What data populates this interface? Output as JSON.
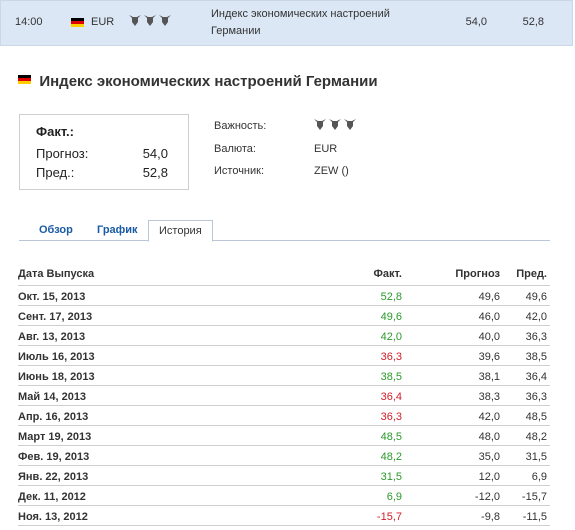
{
  "event_row": {
    "time": "14:00",
    "currency": "EUR",
    "importance": 3,
    "name": "Индекс экономических настроений Германии",
    "actual": "54,0",
    "previous": "52,8"
  },
  "title": "Индекс экономических настроений Германии",
  "fact_box": {
    "fact_label": "Факт.:",
    "forecast_label": "Прогноз:",
    "forecast_value": "54,0",
    "previous_label": "Пред.:",
    "previous_value": "52,8"
  },
  "meta": {
    "importance_label": "Важность:",
    "importance": 3,
    "currency_label": "Валюта:",
    "currency_value": "EUR",
    "source_label": "Источник:",
    "source_value": "ZEW ()"
  },
  "tabs": [
    "Обзор",
    "График",
    "История"
  ],
  "active_tab": "История",
  "history": {
    "headers": {
      "date": "Дата Выпуска",
      "actual": "Факт.",
      "forecast": "Прогноз",
      "previous": "Пред."
    },
    "rows": [
      {
        "date": "Окт. 15, 2013",
        "actual": "52,8",
        "actual_status": "green",
        "forecast": "49,6",
        "previous": "49,6"
      },
      {
        "date": "Сент. 17, 2013",
        "actual": "49,6",
        "actual_status": "green",
        "forecast": "46,0",
        "previous": "42,0"
      },
      {
        "date": "Авг. 13, 2013",
        "actual": "42,0",
        "actual_status": "green",
        "forecast": "40,0",
        "previous": "36,3"
      },
      {
        "date": "Июль 16, 2013",
        "actual": "36,3",
        "actual_status": "red",
        "forecast": "39,6",
        "previous": "38,5"
      },
      {
        "date": "Июнь 18, 2013",
        "actual": "38,5",
        "actual_status": "green",
        "forecast": "38,1",
        "previous": "36,4"
      },
      {
        "date": "Май 14, 2013",
        "actual": "36,4",
        "actual_status": "red",
        "forecast": "38,3",
        "previous": "36,3"
      },
      {
        "date": "Апр. 16, 2013",
        "actual": "36,3",
        "actual_status": "red",
        "forecast": "42,0",
        "previous": "48,5"
      },
      {
        "date": "Март 19, 2013",
        "actual": "48,5",
        "actual_status": "green",
        "forecast": "48,0",
        "previous": "48,2"
      },
      {
        "date": "Фев. 19, 2013",
        "actual": "48,2",
        "actual_status": "green",
        "forecast": "35,0",
        "previous": "31,5"
      },
      {
        "date": "Янв. 22, 2013",
        "actual": "31,5",
        "actual_status": "green",
        "forecast": "12,0",
        "previous": "6,9"
      },
      {
        "date": "Дек. 11, 2012",
        "actual": "6,9",
        "actual_status": "green",
        "forecast": "-12,0",
        "previous": "-15,7"
      },
      {
        "date": "Ноя. 13, 2012",
        "actual": "-15,7",
        "actual_status": "red",
        "forecast": "-9,8",
        "previous": "-11,5"
      }
    ]
  },
  "colors": {
    "positive": "#2a9a2a",
    "negative": "#d0202a",
    "link": "#1a5aa6",
    "event_row_bg": "#dbe7f5"
  },
  "icons": {
    "flag": "germany-flag-icon",
    "importance": "bull-icon"
  }
}
